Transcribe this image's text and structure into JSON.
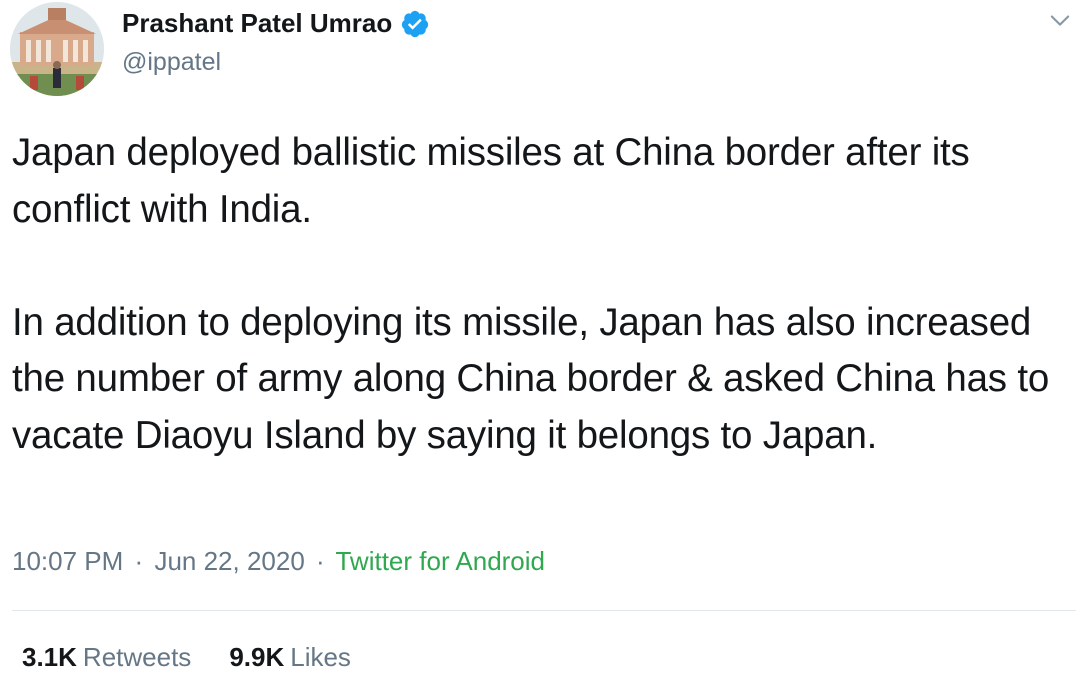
{
  "author": {
    "display_name": "Prashant Patel Umrao",
    "handle": "@ippatel",
    "verified": true,
    "avatar_icon": "building-avatar"
  },
  "tweet": {
    "paragraphs": [
      "Japan deployed ballistic missiles at China border after its conflict with India.",
      "In addition to deploying its missile, Japan has also increased the number of army along China border & asked China has to vacate Diaoyu Island by saying it belongs to Japan."
    ],
    "time": "10:07 PM",
    "separator": "·",
    "date": "Jun 22, 2020",
    "source": "Twitter for Android"
  },
  "stats": {
    "retweets_count": "3.1K",
    "retweets_label": "Retweets",
    "likes_count": "9.9K",
    "likes_label": "Likes"
  },
  "colors": {
    "text": "#14171a",
    "secondary": "#657786",
    "verified": "#1da1f2",
    "source_link": "#2fa84f",
    "divider": "#e1e8ed"
  },
  "icons": {
    "verified": "verified-badge-icon",
    "more": "chevron-down-icon"
  }
}
